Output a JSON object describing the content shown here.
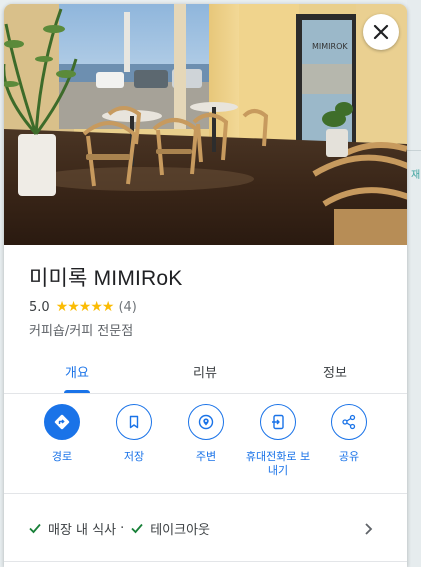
{
  "place": {
    "name": "미미록 MIMIRoK",
    "rating": "5.0",
    "stars": "★★★★★",
    "review_count": "(4)",
    "category": "커피숍/커피 전문점"
  },
  "photo": {
    "door_sign": "MIMIROK"
  },
  "tabs": [
    {
      "label": "개요",
      "active": true
    },
    {
      "label": "리뷰",
      "active": false
    },
    {
      "label": "정보",
      "active": false
    }
  ],
  "actions": [
    {
      "label": "경로",
      "icon": "directions-icon"
    },
    {
      "label": "저장",
      "icon": "bookmark-icon"
    },
    {
      "label": "주변",
      "icon": "nearby-icon"
    },
    {
      "label": "휴대전화로 보내기",
      "icon": "send-to-phone-icon"
    },
    {
      "label": "공유",
      "icon": "share-icon"
    }
  ],
  "service_options": {
    "items": [
      "매장 내 식사",
      "테이크아웃"
    ],
    "separator": "·"
  },
  "map": {
    "side_label": "재"
  },
  "colors": {
    "accent": "#1a73e8",
    "star": "#fbbc04",
    "check": "#188038"
  }
}
